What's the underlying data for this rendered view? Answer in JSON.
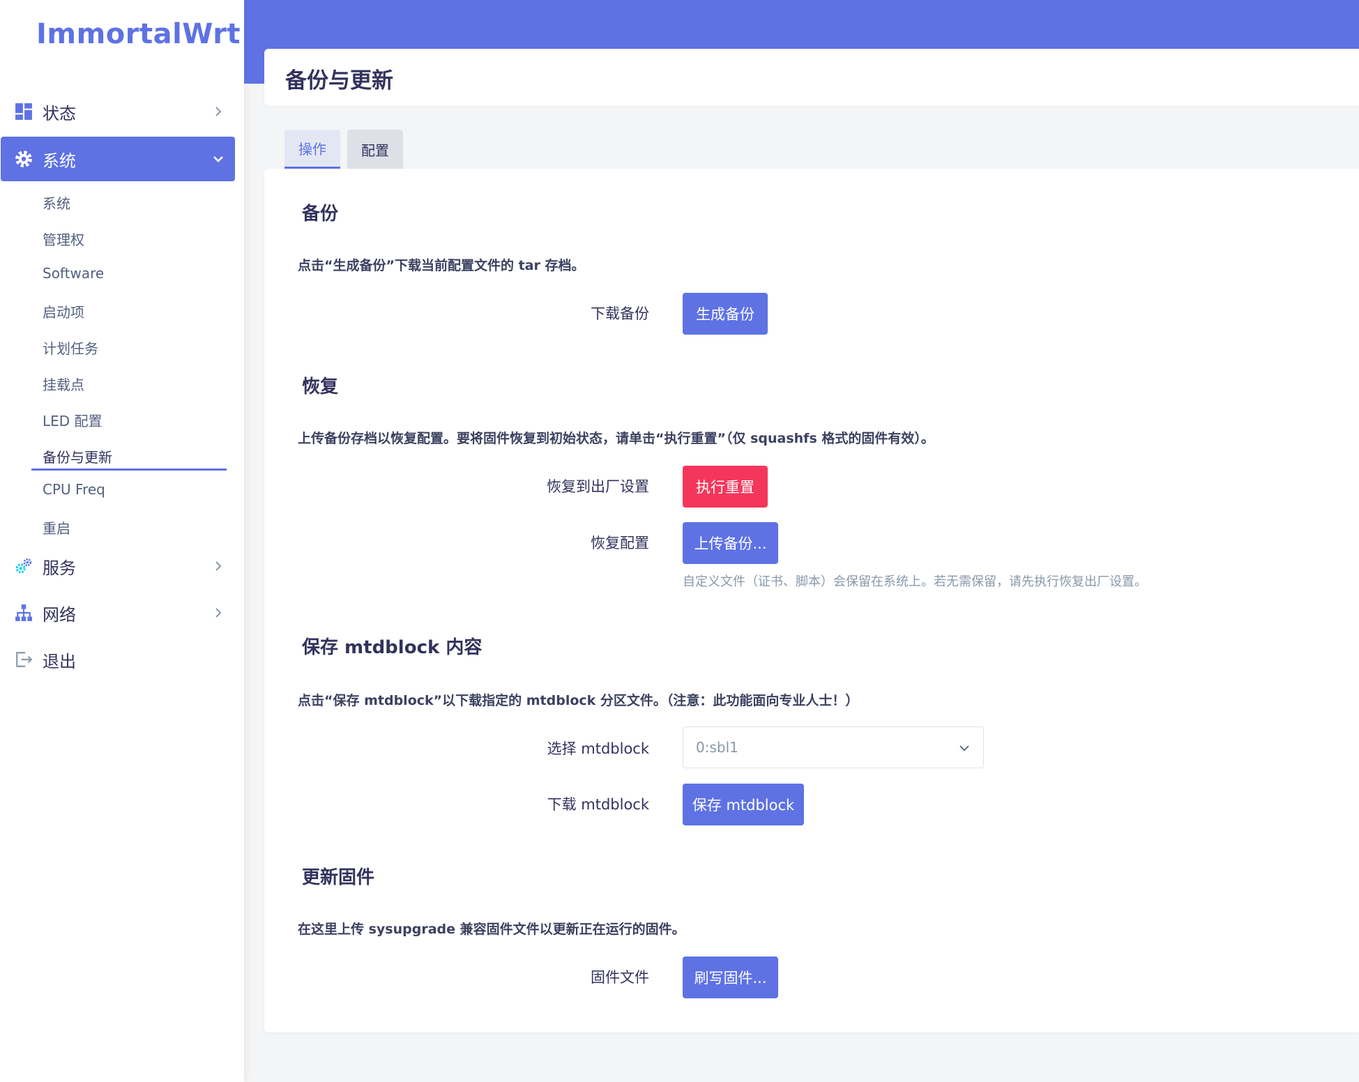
{
  "app": {
    "logo": "ImmortalWrt"
  },
  "sidebar": {
    "items": [
      {
        "label": "状态",
        "icon": "dashboard-icon"
      },
      {
        "label": "系统",
        "icon": "gear-icon",
        "active": true
      },
      {
        "label": "服务",
        "icon": "services-icon"
      },
      {
        "label": "网络",
        "icon": "network-icon"
      },
      {
        "label": "退出",
        "icon": "logout-icon"
      }
    ],
    "system_sub": [
      "系统",
      "管理权",
      "Software",
      "启动项",
      "计划任务",
      "挂载点",
      "LED 配置",
      "备份与更新",
      "CPU Freq",
      "重启"
    ],
    "active_sub": "备份与更新"
  },
  "page": {
    "title": "备份与更新"
  },
  "tabs": [
    {
      "label": "操作",
      "active": true
    },
    {
      "label": "配置",
      "active": false
    }
  ],
  "backup": {
    "title": "备份",
    "desc": "点击“生成备份”下载当前配置文件的 tar 存档。",
    "label": "下载备份",
    "button": "生成备份"
  },
  "restore": {
    "title": "恢复",
    "desc": "上传备份存档以恢复配置。要将固件恢复到初始状态，请单击“执行重置”（仅 squashfs 格式的固件有效）。",
    "reset_label": "恢复到出厂设置",
    "reset_button": "执行重置",
    "restore_label": "恢复配置",
    "upload_button": "上传备份...",
    "hint": "自定义文件（证书、脚本）会保留在系统上。若无需保留，请先执行恢复出厂设置。"
  },
  "mtdblock": {
    "title": "保存 mtdblock 内容",
    "desc": "点击“保存 mtdblock”以下载指定的 mtdblock 分区文件。（注意：此功能面向专业人士！）",
    "select_label": "选择 mtdblock",
    "select_value": "0:sbl1",
    "download_label": "下载 mtdblock",
    "save_button": "保存 mtdblock"
  },
  "firmware": {
    "title": "更新固件",
    "desc": "在这里上传 sysupgrade 兼容固件文件以更新正在运行的固件。",
    "label": "固件文件",
    "button": "刷写固件..."
  },
  "colors": {
    "accent": "#5e72e4",
    "danger": "#f5365c",
    "text": "#32325d"
  }
}
